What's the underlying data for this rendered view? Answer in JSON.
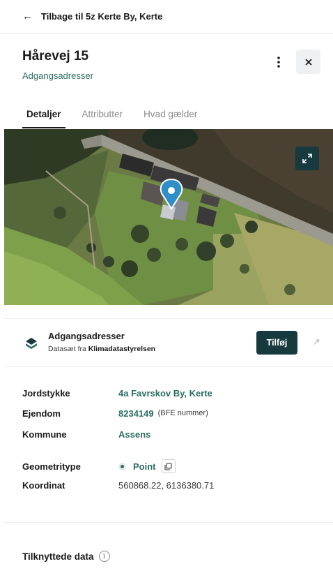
{
  "back": {
    "label": "Tilbage til 5z Kerte By, Kerte"
  },
  "header": {
    "title": "Hårevej 15",
    "subtitle": "Adgangsadresser"
  },
  "tabs": [
    {
      "label": "Detaljer",
      "active": true
    },
    {
      "label": "Attributter",
      "active": false
    },
    {
      "label": "Hvad gælder",
      "active": false
    }
  ],
  "map": {
    "marker_color": "#2e8fc8"
  },
  "dataset": {
    "title": "Adgangsadresser",
    "source_prefix": "Datasæt fra",
    "source_name": "Klimadatastyrelsen",
    "add_label": "Tilføj"
  },
  "details": {
    "jordstykke": {
      "label": "Jordstykke",
      "value": "4a Favrskov By, Kerte"
    },
    "ejendom": {
      "label": "Ejendom",
      "value": "8234149",
      "note": "(BFE nummer)"
    },
    "kommune": {
      "label": "Kommune",
      "value": "Assens"
    },
    "geometritype": {
      "label": "Geometritype",
      "value": "Point"
    },
    "koordinat": {
      "label": "Koordinat",
      "value": "560868.22, 6136380.71"
    }
  },
  "linked": {
    "title": "Tilknyttede data",
    "info_icon": "i"
  },
  "colors": {
    "accent": "#2b6d63",
    "dark": "#163a3d"
  }
}
